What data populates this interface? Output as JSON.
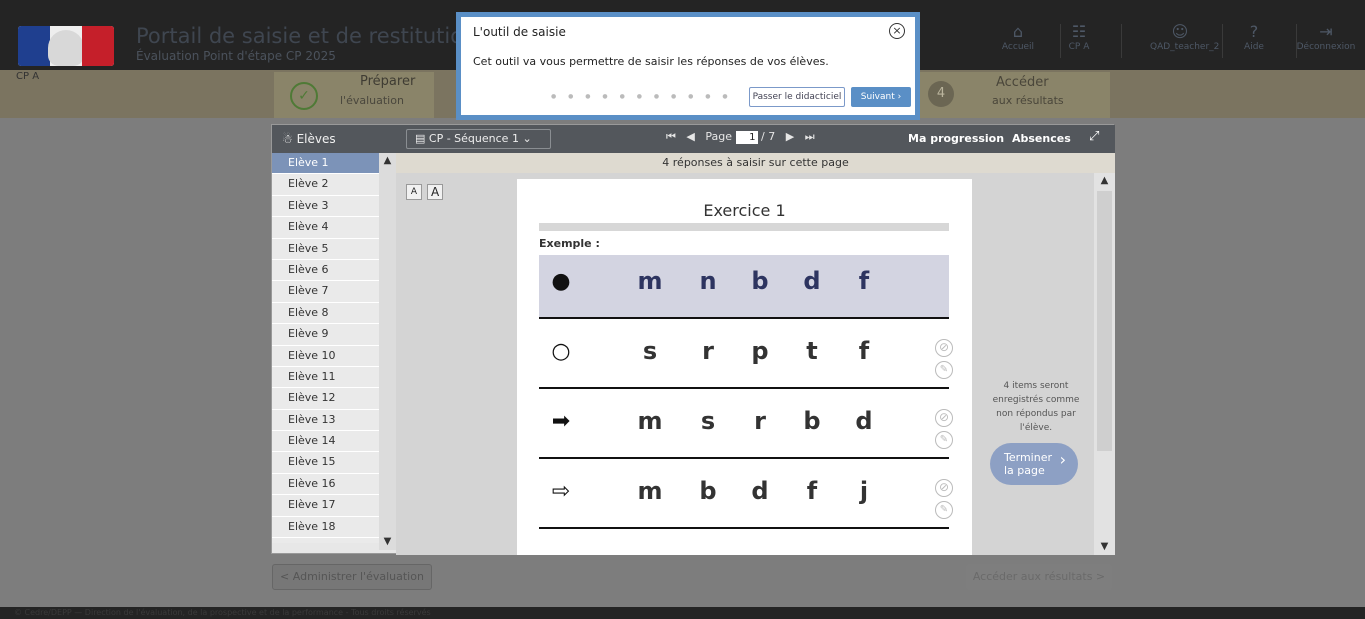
{
  "header": {
    "title": "Portail de saisie et de restitution",
    "subtitle": "Évaluation Point d'étape CP 2025",
    "nav": [
      {
        "name": "nav-home",
        "icon": "home-icon",
        "glyph": "⌂",
        "label": "Accueil"
      },
      {
        "name": "nav-class",
        "icon": "group-icon",
        "glyph": "☷",
        "label": "CP A"
      },
      {
        "name": "nav-user",
        "icon": "user-icon",
        "glyph": "☺",
        "label": "QAD_teacher_2"
      },
      {
        "name": "nav-help",
        "icon": "help-icon",
        "glyph": "?",
        "label": "Aide"
      },
      {
        "name": "nav-logout",
        "icon": "logout-icon",
        "glyph": "⇥",
        "label": "Déconnexion"
      }
    ]
  },
  "subbar": {
    "class_label": "CP A",
    "step1_title": "Préparer",
    "step1_sub": "l'évaluation",
    "step4_num": "4",
    "step4_title": "Accéder",
    "step4_sub": "aux résultats"
  },
  "students": {
    "header": "Elèves",
    "items": [
      "Elève 1",
      "Elève 2",
      "Elève 3",
      "Elève 4",
      "Elève 5",
      "Elève 6",
      "Elève 7",
      "Elève 8",
      "Elève 9",
      "Elève 10",
      "Elève 11",
      "Elève 12",
      "Elève 13",
      "Elève 14",
      "Elève 15",
      "Elève 16",
      "Elève 17",
      "Elève 18"
    ],
    "active_index": 0
  },
  "toolbar": {
    "sequence": "CP - Séquence 1",
    "page_label": "Page",
    "page_current": "1",
    "page_total": "/ 7",
    "progress": "Ma progression",
    "absences": "Absences"
  },
  "summary": "4 réponses à saisir sur cette page",
  "font_buttons": {
    "small": "A",
    "large": "A"
  },
  "exercise": {
    "title": "Exercice 1",
    "example_label": "Exemple :",
    "rows": [
      {
        "name": "example-row",
        "example": true,
        "symbol": "●",
        "symbol_icon": "filled-circle-icon",
        "letters": [
          "m",
          "n",
          "b",
          "d",
          "f"
        ]
      },
      {
        "name": "item-row-1",
        "example": false,
        "symbol": "○",
        "symbol_icon": "empty-circle-icon",
        "letters": [
          "s",
          "r",
          "p",
          "t",
          "f"
        ]
      },
      {
        "name": "item-row-2",
        "example": false,
        "symbol": "➡",
        "symbol_icon": "filled-arrow-icon",
        "letters": [
          "m",
          "s",
          "r",
          "b",
          "d"
        ]
      },
      {
        "name": "item-row-3",
        "example": false,
        "symbol": "⇨",
        "symbol_icon": "outline-arrow-icon",
        "letters": [
          "m",
          "b",
          "d",
          "f",
          "j"
        ]
      }
    ]
  },
  "side": {
    "not_answered": "4 items seront enregistrés comme non répondus par l'élève.",
    "finish_line1": "Terminer",
    "finish_line2": "la page"
  },
  "bottom": {
    "admin": "< Administrer l'évaluation",
    "results": "Accéder aux résultats >"
  },
  "footer": "© Cedre/DEPP — Direction de l'évaluation, de la prospective et de la performance - Tous droits réservés",
  "tour": {
    "title": "L'outil de saisie",
    "body": "Cet outil va vous permettre de saisir les réponses de vos élèves.",
    "skip": "Passer le didacticiel",
    "next": "Suivant ›",
    "dots": "● ● ● ● ● ● ● ● ● ● ●"
  }
}
